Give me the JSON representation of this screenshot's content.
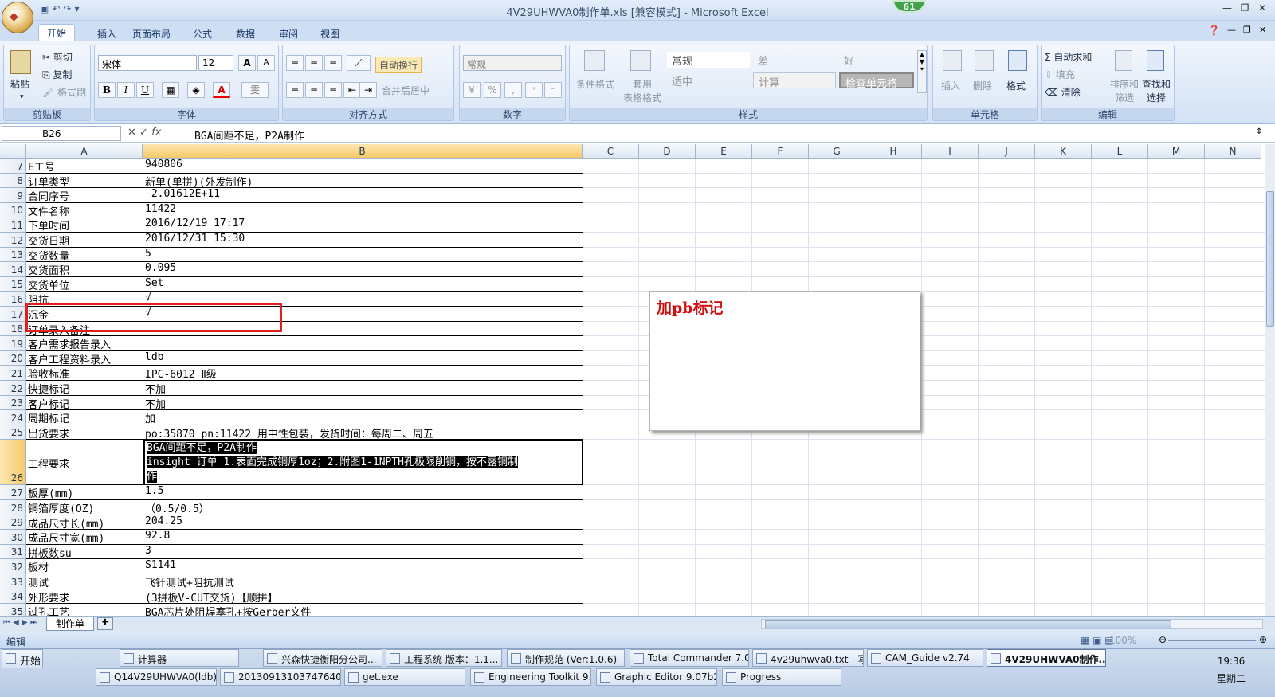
{
  "window": {
    "title": "4V29UHWVA0制作单.xls  [兼容模式] - Microsoft Excel",
    "badge": "61"
  },
  "ribbon_tabs": [
    "开始",
    "插入",
    "页面布局",
    "公式",
    "数据",
    "审阅",
    "视图"
  ],
  "ribbon": {
    "clipboard": {
      "label": "剪贴板",
      "paste": "粘贴",
      "cut": "剪切",
      "copy": "复制",
      "format_painter": "格式刷"
    },
    "font": {
      "label": "字体",
      "name": "宋体",
      "size": "12",
      "bold": "B",
      "italic": "I",
      "underline": "U",
      "grow": "A",
      "shrink": "A",
      "fontcolor": "A",
      "phonetic": "雯"
    },
    "alignment": {
      "label": "对齐方式",
      "wrap": "自动换行",
      "merge": "合并后居中"
    },
    "number": {
      "label": "数字",
      "format": "常规",
      "percent": "%"
    },
    "styles": {
      "label": "样式",
      "conditional": "条件格式",
      "table": "套用\n表格格式",
      "normal": "常规",
      "bad": "差",
      "good": "好",
      "neutral": "适中",
      "calc": "计算",
      "check": "检查单元格"
    },
    "cells": {
      "label": "单元格",
      "insert": "插入",
      "delete": "删除",
      "format": "格式"
    },
    "editing": {
      "label": "编辑",
      "autosum": "Σ 自动求和",
      "fill": "填充",
      "clear": "清除",
      "sort": "排序和\n筛选",
      "find": "查找和\n选择"
    }
  },
  "formula_bar": {
    "name_box": "B26",
    "fx": "fx",
    "formula": "BGA间距不足，P2A制作"
  },
  "columns": [
    "A",
    "B",
    "C",
    "D",
    "E",
    "F",
    "G",
    "H",
    "I",
    "J",
    "K",
    "L",
    "M",
    "N"
  ],
  "rows": [
    {
      "n": "7",
      "a": "E工号",
      "b": "940806"
    },
    {
      "n": "8",
      "a": "订单类型",
      "b": "新单(单拼)(外发制作)"
    },
    {
      "n": "9",
      "a": "合同序号",
      "b": "-2.01612E+11"
    },
    {
      "n": "10",
      "a": "文件名称",
      "b": "11422"
    },
    {
      "n": "11",
      "a": "下单时间",
      "b": "2016/12/19 17:17"
    },
    {
      "n": "12",
      "a": "交货日期",
      "b": "2016/12/31 15:30"
    },
    {
      "n": "13",
      "a": "交货数量",
      "b": "5"
    },
    {
      "n": "14",
      "a": "交货面积",
      "b": "0.095"
    },
    {
      "n": "15",
      "a": "交货单位",
      "b": "Set"
    },
    {
      "n": "16",
      "a": "阻抗",
      "b": "√"
    },
    {
      "n": "17",
      "a": "沉金",
      "b": "√"
    },
    {
      "n": "18",
      "a": "订单录入备注",
      "b": ""
    },
    {
      "n": "19",
      "a": "客户需求报告录入",
      "b": ""
    },
    {
      "n": "20",
      "a": "客户工程资料录入",
      "b": "ldb"
    },
    {
      "n": "21",
      "a": "验收标准",
      "b": "IPC-6012 Ⅱ级"
    },
    {
      "n": "22",
      "a": "快捷标记",
      "b": "不加"
    },
    {
      "n": "23",
      "a": "客户标记",
      "b": "不加"
    },
    {
      "n": "24",
      "a": "周期标记",
      "b": "加"
    },
    {
      "n": "25",
      "a": "出货要求",
      "b": "po:35870 pn:11422 用中性包装，发货时间：每周二、周五"
    },
    {
      "n": "26",
      "a": "工程要求",
      "b": ""
    },
    {
      "n": "27",
      "a": "板厚(mm)",
      "b": "1.5"
    },
    {
      "n": "28",
      "a": "铜箔厚度(OZ)",
      "b": "（0.5/0.5）"
    },
    {
      "n": "29",
      "a": "成品尺寸长(mm)",
      "b": "204.25"
    },
    {
      "n": "30",
      "a": "成品尺寸宽(mm)",
      "b": "92.8"
    },
    {
      "n": "31",
      "a": "拼板数su",
      "b": "3"
    },
    {
      "n": "32",
      "a": "板材",
      "b": "S1141"
    },
    {
      "n": "33",
      "a": "测试",
      "b": "飞针测试+阻抗测试"
    },
    {
      "n": "34",
      "a": "外形要求",
      "b": "(3拼板V-CUT交货)【顺拼】"
    },
    {
      "n": "35",
      "a": "过孔工艺",
      "b": "BGA芯片处阻焊塞孔+按Gerber文件"
    }
  ],
  "cell_b26_lines": [
    "BGA间距不足，P2A制作",
    "insight 订单 1.表面完成铜厚1oz；2.附图1-1NPTH孔极限削铜，按不露铜制",
    "作"
  ],
  "note": "加pb标记",
  "sheet_tab": "制作单",
  "status": {
    "mode": "编辑",
    "zoom": "100%"
  },
  "taskbar": {
    "start": "开始",
    "row1": [
      "计算器",
      "兴森快捷衡阳分公司...",
      "工程系统  版本：1.1...",
      "制作规范 (Ver:1.0.6)",
      "Total Commander 7.0 p...",
      "4v29uhwva0.txt - 写...",
      "CAM_Guide v2.74",
      "4V29UHWVA0制作..."
    ],
    "row2": [
      "Q14V29UHWVA0(ldb)20...",
      "20130913103747640.rtf...",
      "get.exe",
      "Engineering Toolkit 9.07...",
      "Graphic Editor 9.07b2 (0...",
      "Progress"
    ],
    "time": "19:36",
    "day": "星期二"
  }
}
